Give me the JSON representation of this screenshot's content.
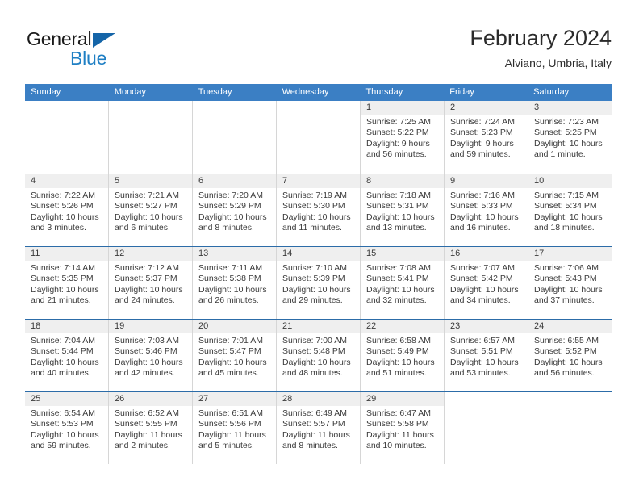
{
  "brand": {
    "name_part1": "General",
    "name_part2": "Blue",
    "triangle_icon": "triangle-icon",
    "accent_dark": "#1565a8",
    "accent_light": "#1f7fc4"
  },
  "header": {
    "title": "February 2024",
    "subtitle": "Alviano, Umbria, Italy"
  },
  "theme": {
    "header_blue": "#3b7fc4",
    "row_divider_blue": "#2c6ca8",
    "daynum_band": "#efefef",
    "text": "#3a3a3a"
  },
  "weekdays": [
    "Sunday",
    "Monday",
    "Tuesday",
    "Wednesday",
    "Thursday",
    "Friday",
    "Saturday"
  ],
  "weeks": [
    [
      {
        "day": "",
        "sunrise": "",
        "sunset": "",
        "daylight": "",
        "empty": true
      },
      {
        "day": "",
        "sunrise": "",
        "sunset": "",
        "daylight": "",
        "empty": true
      },
      {
        "day": "",
        "sunrise": "",
        "sunset": "",
        "daylight": "",
        "empty": true
      },
      {
        "day": "",
        "sunrise": "",
        "sunset": "",
        "daylight": "",
        "empty": true
      },
      {
        "day": "1",
        "sunrise": "Sunrise: 7:25 AM",
        "sunset": "Sunset: 5:22 PM",
        "daylight": "Daylight: 9 hours and 56 minutes.",
        "empty": false
      },
      {
        "day": "2",
        "sunrise": "Sunrise: 7:24 AM",
        "sunset": "Sunset: 5:23 PM",
        "daylight": "Daylight: 9 hours and 59 minutes.",
        "empty": false
      },
      {
        "day": "3",
        "sunrise": "Sunrise: 7:23 AM",
        "sunset": "Sunset: 5:25 PM",
        "daylight": "Daylight: 10 hours and 1 minute.",
        "empty": false
      }
    ],
    [
      {
        "day": "4",
        "sunrise": "Sunrise: 7:22 AM",
        "sunset": "Sunset: 5:26 PM",
        "daylight": "Daylight: 10 hours and 3 minutes.",
        "empty": false
      },
      {
        "day": "5",
        "sunrise": "Sunrise: 7:21 AM",
        "sunset": "Sunset: 5:27 PM",
        "daylight": "Daylight: 10 hours and 6 minutes.",
        "empty": false
      },
      {
        "day": "6",
        "sunrise": "Sunrise: 7:20 AM",
        "sunset": "Sunset: 5:29 PM",
        "daylight": "Daylight: 10 hours and 8 minutes.",
        "empty": false
      },
      {
        "day": "7",
        "sunrise": "Sunrise: 7:19 AM",
        "sunset": "Sunset: 5:30 PM",
        "daylight": "Daylight: 10 hours and 11 minutes.",
        "empty": false
      },
      {
        "day": "8",
        "sunrise": "Sunrise: 7:18 AM",
        "sunset": "Sunset: 5:31 PM",
        "daylight": "Daylight: 10 hours and 13 minutes.",
        "empty": false
      },
      {
        "day": "9",
        "sunrise": "Sunrise: 7:16 AM",
        "sunset": "Sunset: 5:33 PM",
        "daylight": "Daylight: 10 hours and 16 minutes.",
        "empty": false
      },
      {
        "day": "10",
        "sunrise": "Sunrise: 7:15 AM",
        "sunset": "Sunset: 5:34 PM",
        "daylight": "Daylight: 10 hours and 18 minutes.",
        "empty": false
      }
    ],
    [
      {
        "day": "11",
        "sunrise": "Sunrise: 7:14 AM",
        "sunset": "Sunset: 5:35 PM",
        "daylight": "Daylight: 10 hours and 21 minutes.",
        "empty": false
      },
      {
        "day": "12",
        "sunrise": "Sunrise: 7:12 AM",
        "sunset": "Sunset: 5:37 PM",
        "daylight": "Daylight: 10 hours and 24 minutes.",
        "empty": false
      },
      {
        "day": "13",
        "sunrise": "Sunrise: 7:11 AM",
        "sunset": "Sunset: 5:38 PM",
        "daylight": "Daylight: 10 hours and 26 minutes.",
        "empty": false
      },
      {
        "day": "14",
        "sunrise": "Sunrise: 7:10 AM",
        "sunset": "Sunset: 5:39 PM",
        "daylight": "Daylight: 10 hours and 29 minutes.",
        "empty": false
      },
      {
        "day": "15",
        "sunrise": "Sunrise: 7:08 AM",
        "sunset": "Sunset: 5:41 PM",
        "daylight": "Daylight: 10 hours and 32 minutes.",
        "empty": false
      },
      {
        "day": "16",
        "sunrise": "Sunrise: 7:07 AM",
        "sunset": "Sunset: 5:42 PM",
        "daylight": "Daylight: 10 hours and 34 minutes.",
        "empty": false
      },
      {
        "day": "17",
        "sunrise": "Sunrise: 7:06 AM",
        "sunset": "Sunset: 5:43 PM",
        "daylight": "Daylight: 10 hours and 37 minutes.",
        "empty": false
      }
    ],
    [
      {
        "day": "18",
        "sunrise": "Sunrise: 7:04 AM",
        "sunset": "Sunset: 5:44 PM",
        "daylight": "Daylight: 10 hours and 40 minutes.",
        "empty": false
      },
      {
        "day": "19",
        "sunrise": "Sunrise: 7:03 AM",
        "sunset": "Sunset: 5:46 PM",
        "daylight": "Daylight: 10 hours and 42 minutes.",
        "empty": false
      },
      {
        "day": "20",
        "sunrise": "Sunrise: 7:01 AM",
        "sunset": "Sunset: 5:47 PM",
        "daylight": "Daylight: 10 hours and 45 minutes.",
        "empty": false
      },
      {
        "day": "21",
        "sunrise": "Sunrise: 7:00 AM",
        "sunset": "Sunset: 5:48 PM",
        "daylight": "Daylight: 10 hours and 48 minutes.",
        "empty": false
      },
      {
        "day": "22",
        "sunrise": "Sunrise: 6:58 AM",
        "sunset": "Sunset: 5:49 PM",
        "daylight": "Daylight: 10 hours and 51 minutes.",
        "empty": false
      },
      {
        "day": "23",
        "sunrise": "Sunrise: 6:57 AM",
        "sunset": "Sunset: 5:51 PM",
        "daylight": "Daylight: 10 hours and 53 minutes.",
        "empty": false
      },
      {
        "day": "24",
        "sunrise": "Sunrise: 6:55 AM",
        "sunset": "Sunset: 5:52 PM",
        "daylight": "Daylight: 10 hours and 56 minutes.",
        "empty": false
      }
    ],
    [
      {
        "day": "25",
        "sunrise": "Sunrise: 6:54 AM",
        "sunset": "Sunset: 5:53 PM",
        "daylight": "Daylight: 10 hours and 59 minutes.",
        "empty": false
      },
      {
        "day": "26",
        "sunrise": "Sunrise: 6:52 AM",
        "sunset": "Sunset: 5:55 PM",
        "daylight": "Daylight: 11 hours and 2 minutes.",
        "empty": false
      },
      {
        "day": "27",
        "sunrise": "Sunrise: 6:51 AM",
        "sunset": "Sunset: 5:56 PM",
        "daylight": "Daylight: 11 hours and 5 minutes.",
        "empty": false
      },
      {
        "day": "28",
        "sunrise": "Sunrise: 6:49 AM",
        "sunset": "Sunset: 5:57 PM",
        "daylight": "Daylight: 11 hours and 8 minutes.",
        "empty": false
      },
      {
        "day": "29",
        "sunrise": "Sunrise: 6:47 AM",
        "sunset": "Sunset: 5:58 PM",
        "daylight": "Daylight: 11 hours and 10 minutes.",
        "empty": false
      },
      {
        "day": "",
        "sunrise": "",
        "sunset": "",
        "daylight": "",
        "empty": true
      },
      {
        "day": "",
        "sunrise": "",
        "sunset": "",
        "daylight": "",
        "empty": true
      }
    ]
  ]
}
